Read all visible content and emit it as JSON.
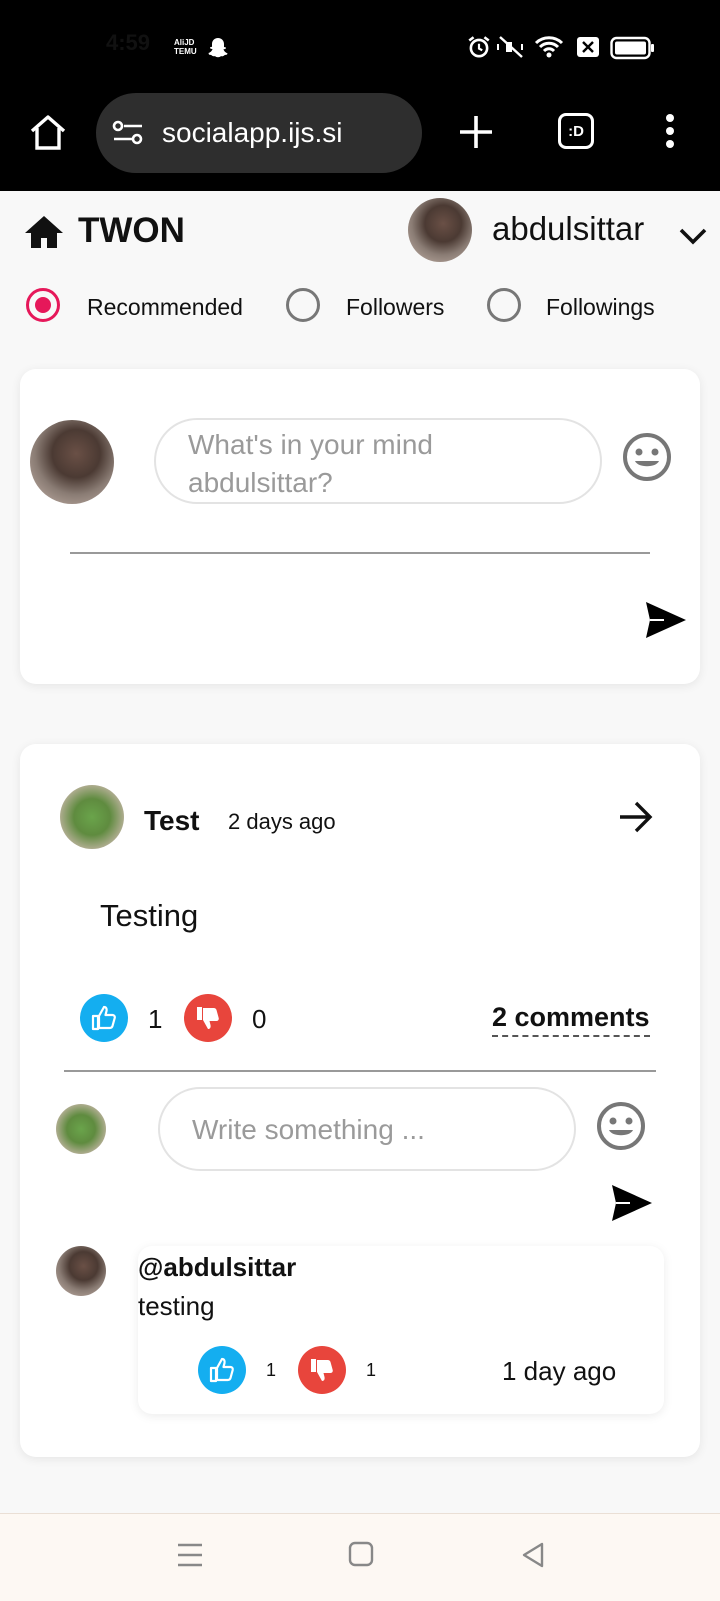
{
  "status_bar": {
    "time": "4:59",
    "carrier_badge": "TEMU"
  },
  "browser": {
    "url": "socialapp.ijs.si",
    "tab_switcher_label": ":D"
  },
  "header": {
    "brand": "TWON",
    "username": "abdulsittar"
  },
  "feed_filter": {
    "options": [
      "Recommended",
      "Followers",
      "Followings"
    ],
    "selected": "Recommended"
  },
  "composer": {
    "placeholder": "What's in your mind abdulsittar?"
  },
  "post": {
    "author": "Test",
    "time": "2 days ago",
    "content": "Testing",
    "likes": "1",
    "dislikes": "0",
    "comments_link": "2 comments",
    "comment_placeholder": "Write something ...",
    "comment": {
      "author": "@abdulsittar",
      "text": "testing",
      "likes": "1",
      "dislikes": "1",
      "time": "1 day ago"
    }
  },
  "colors": {
    "accent": "#e6185a",
    "like": "#14aef0",
    "dislike": "#e8453c"
  }
}
